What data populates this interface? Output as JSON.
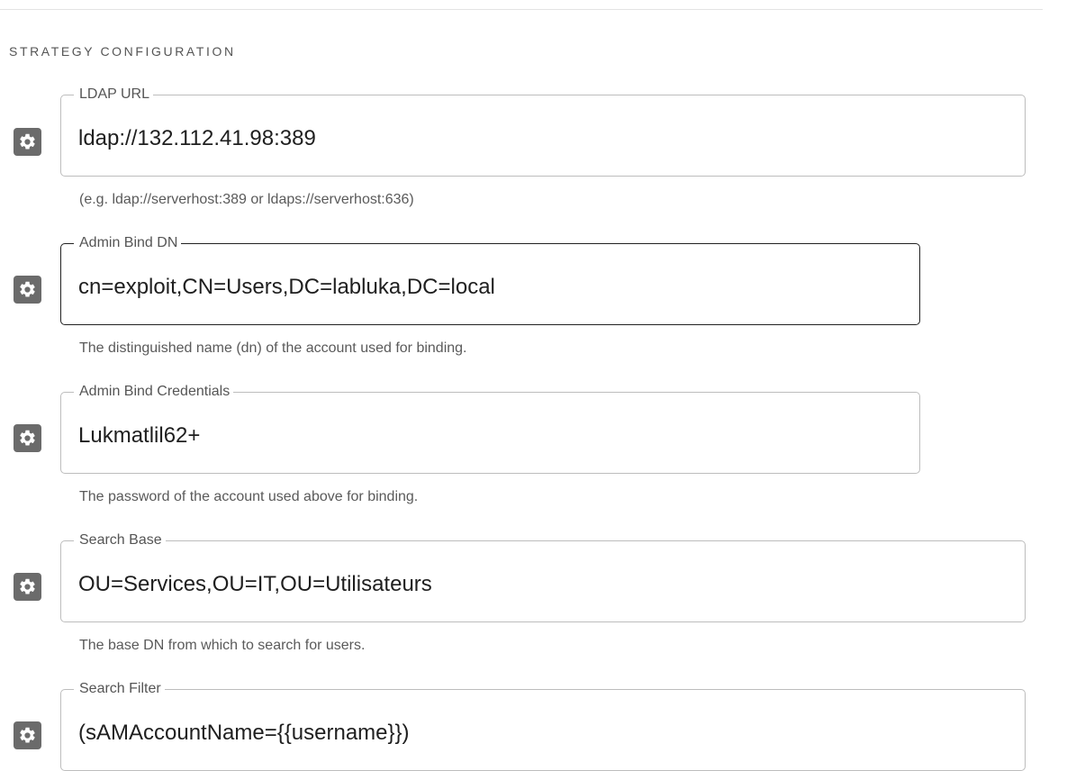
{
  "section": {
    "title": "STRATEGY CONFIGURATION"
  },
  "fields": [
    {
      "label": "LDAP URL",
      "value": "ldap://132.112.41.98:389",
      "helper": "(e.g. ldap://serverhost:389 or ldaps://serverhost:636)",
      "icon": "gear-icon"
    },
    {
      "label": "Admin Bind DN",
      "value": "cn=exploit,CN=Users,DC=labluka,DC=local",
      "helper": "The distinguished name (dn) of the account used for binding.",
      "icon": "gear-icon"
    },
    {
      "label": "Admin Bind Credentials",
      "value": "Lukmatlil62+",
      "helper": "The password of the account used above for binding.",
      "icon": "gear-icon"
    },
    {
      "label": "Search Base",
      "value": "OU=Services,OU=IT,OU=Utilisateurs",
      "helper": "The base DN from which to search for users.",
      "icon": "gear-icon"
    },
    {
      "label": "Search Filter",
      "value": "(sAMAccountName={{username}})",
      "helper": "",
      "icon": "gear-icon"
    }
  ]
}
